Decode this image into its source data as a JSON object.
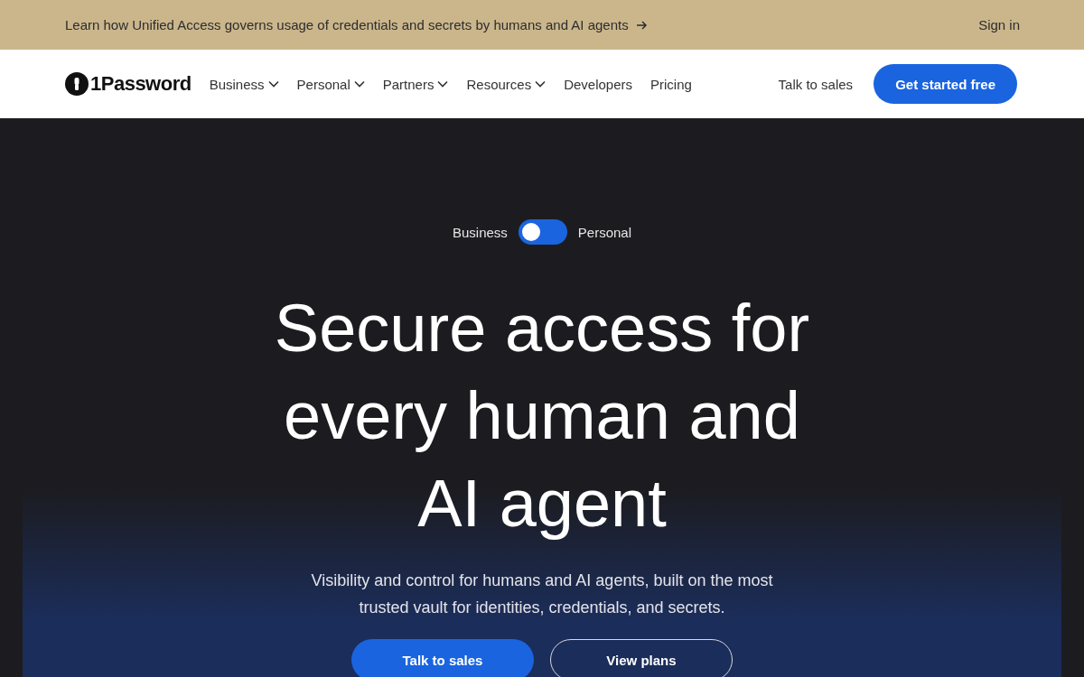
{
  "banner": {
    "text": "Learn how Unified Access governs usage of credentials and secrets by humans and AI agents",
    "sign_in": "Sign in"
  },
  "nav": {
    "logo": "1Password",
    "items": [
      {
        "label": "Business",
        "has_menu": true
      },
      {
        "label": "Personal",
        "has_menu": true
      },
      {
        "label": "Partners",
        "has_menu": true
      },
      {
        "label": "Resources",
        "has_menu": true
      },
      {
        "label": "Developers",
        "has_menu": false
      },
      {
        "label": "Pricing",
        "has_menu": false
      }
    ],
    "talk_to_sales": "Talk to sales",
    "cta": "Get started free"
  },
  "hero": {
    "toggle": {
      "left_label": "Business",
      "right_label": "Personal",
      "on": false
    },
    "heading": "Secure access for every human and AI agent",
    "subheading": "Visibility and control for humans and AI agents, built on the most trusted vault for identities, credentials, and secrets.",
    "buttons": [
      {
        "label": "Talk to sales",
        "kind": "primary"
      },
      {
        "label": "View plans",
        "kind": "outline"
      }
    ]
  }
}
